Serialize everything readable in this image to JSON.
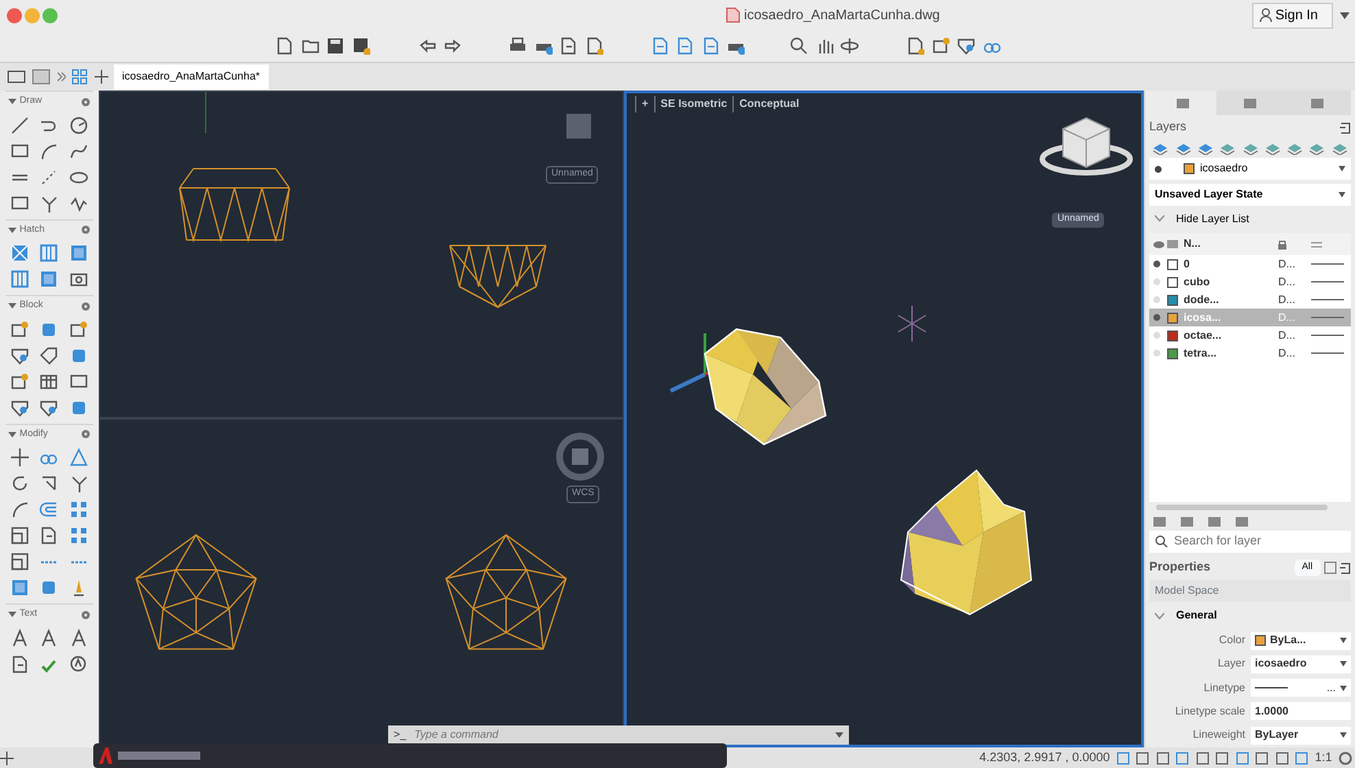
{
  "window": {
    "title": "icosaedro_AnaMartaCunha.dwg"
  },
  "account": {
    "label": "Sign In"
  },
  "file_tabs": [
    {
      "label": "icosaedro_AnaMartaCunha*",
      "selected": true
    }
  ],
  "tool_palette": {
    "sections": [
      {
        "title": "Draw",
        "expanded": true
      },
      {
        "title": "Hatch",
        "expanded": true
      },
      {
        "title": "Block",
        "expanded": true
      },
      {
        "title": "Modify",
        "expanded": true
      },
      {
        "title": "Text",
        "expanded": true
      }
    ]
  },
  "viewports": [
    {
      "label": "Unnamed",
      "active": false
    },
    {
      "label": "WCS",
      "active": false
    },
    {
      "menu": "+",
      "view": "SE Isometric",
      "style": "Conceptual",
      "label": "Unnamed",
      "active": true
    }
  ],
  "layers_panel": {
    "title": "Layers",
    "current_layer": {
      "name": "icosaedro",
      "color": "#e8a23c"
    },
    "layer_state": "Unsaved Layer State",
    "toggle": "Hide Layer List",
    "name_column": "N...",
    "layers": [
      {
        "name": "0",
        "color": "#ffffff",
        "linetype": "D...",
        "in_use": true,
        "selected": false
      },
      {
        "name": "cubo",
        "color": "#ffffff",
        "linetype": "D...",
        "in_use": false,
        "selected": false
      },
      {
        "name": "dode...",
        "color": "#1f8fb0",
        "linetype": "D...",
        "in_use": false,
        "selected": false
      },
      {
        "name": "icosa...",
        "color": "#e8a23c",
        "linetype": "D...",
        "in_use": true,
        "selected": true
      },
      {
        "name": "octae...",
        "color": "#c0281c",
        "linetype": "D...",
        "in_use": false,
        "selected": false
      },
      {
        "name": "tetra...",
        "color": "#4a9a4a",
        "linetype": "D...",
        "in_use": false,
        "selected": false
      }
    ],
    "search": {
      "placeholder": "Search for layer"
    }
  },
  "properties_panel": {
    "title": "Properties",
    "filter": "All",
    "space": "Model Space",
    "section": "General",
    "rows": [
      {
        "kind": "swatch",
        "label": "Color",
        "value": "ByLa...",
        "color": "#e8a23c"
      },
      {
        "kind": "dropdown",
        "label": "Layer",
        "value": "icosaedro"
      },
      {
        "kind": "linetype",
        "label": "Linetype",
        "value": "..."
      },
      {
        "kind": "text",
        "label": "Linetype scale",
        "value": "1.0000"
      },
      {
        "kind": "dropdown",
        "label": "Lineweight",
        "value": "ByLayer"
      }
    ]
  },
  "command_line": {
    "prompt": ">_",
    "placeholder": "Type a command"
  },
  "status_bar": {
    "coordinates": "4.2303, 2.9917 , 0.0000",
    "scale": "1:1"
  }
}
